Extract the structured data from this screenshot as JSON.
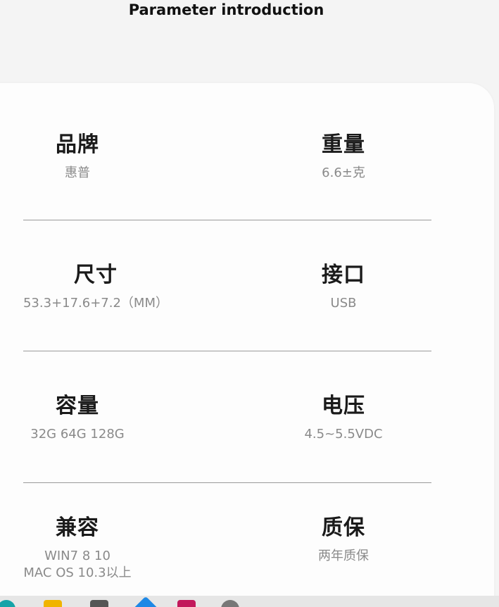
{
  "header": {
    "title": "Parameter introduction"
  },
  "rows": [
    {
      "left": {
        "label": "品牌",
        "value": "惠普"
      },
      "right": {
        "label": "重量",
        "value": "6.6±克"
      }
    },
    {
      "left": {
        "label": "尺寸",
        "value": "53.3+17.6+7.2（MM）"
      },
      "right": {
        "label": "接口",
        "value": "USB"
      }
    },
    {
      "left": {
        "label": "容量",
        "value": "32G 64G 128G"
      },
      "right": {
        "label": "电压",
        "value": "4.5~5.5VDC"
      }
    },
    {
      "left": {
        "label": "兼容",
        "value": "WIN7 8 10\nMAC OS 10.3以上"
      },
      "right": {
        "label": "质保",
        "value": "两年质保"
      }
    }
  ],
  "taskbar": {
    "icons": [
      "chrome-icon",
      "folder-icon",
      "explorer-icon",
      "vscode-icon",
      "app-icon",
      "settings-icon"
    ]
  }
}
